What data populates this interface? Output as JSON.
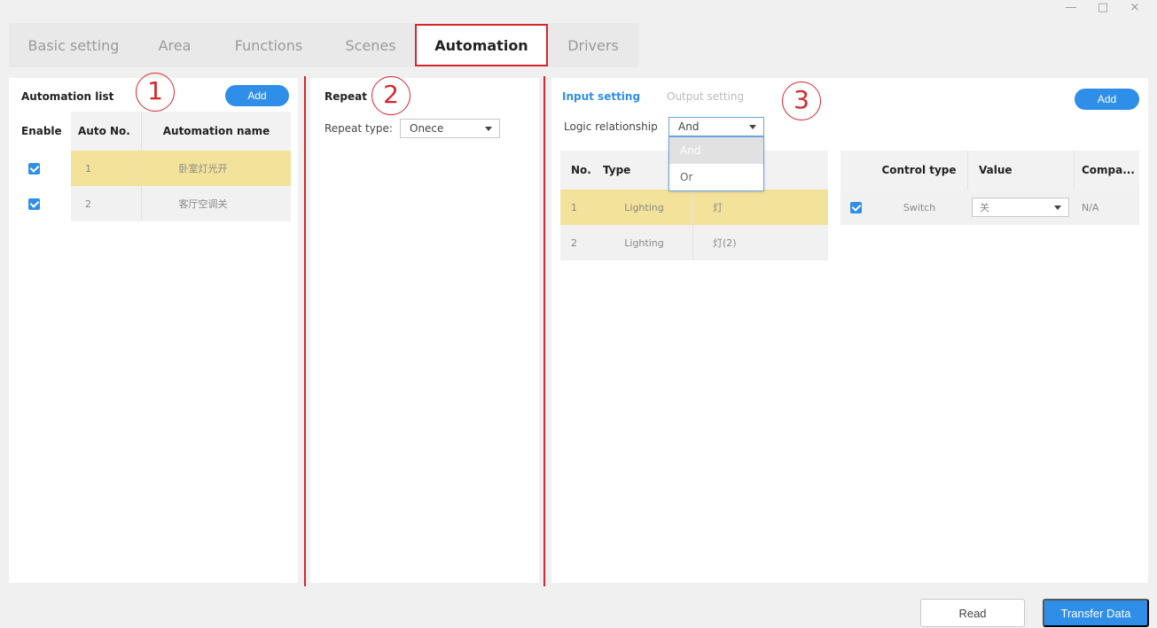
{
  "window": {
    "controls": [
      "—",
      "□",
      "×"
    ]
  },
  "tabs": [
    {
      "label": "Basic setting"
    },
    {
      "label": "Area"
    },
    {
      "label": "Functions"
    },
    {
      "label": "Scenes"
    },
    {
      "label": "Automation"
    },
    {
      "label": "Drivers"
    }
  ],
  "annotations": [
    "1",
    "2",
    "3"
  ],
  "automation_list": {
    "title": "Automation list",
    "add_label": "Add",
    "headers": {
      "enable": "Enable",
      "auto_no": "Auto No.",
      "name": "Automation name"
    },
    "rows": [
      {
        "enabled": true,
        "no": "1",
        "name": "卧室灯光开"
      },
      {
        "enabled": true,
        "no": "2",
        "name": "客厅空调关"
      }
    ]
  },
  "repeat": {
    "title": "Repeat",
    "type_label": "Repeat type:",
    "type_value": "Onece"
  },
  "io": {
    "tabs": {
      "input": "Input setting",
      "output": "Output setting"
    },
    "add_label": "Add",
    "logic_label": "Logic relationship",
    "logic_value": "And",
    "logic_options": [
      "And",
      "Or"
    ],
    "input_table": {
      "headers": {
        "no": "No.",
        "type": "Type"
      },
      "rows": [
        {
          "no": "1",
          "type": "Lighting",
          "device": "灯"
        },
        {
          "no": "2",
          "type": "Lighting",
          "device": "灯(2)"
        }
      ]
    },
    "control_table": {
      "headers": {
        "control_type": "Control type",
        "value": "Value",
        "compare": "Compa..."
      },
      "rows": [
        {
          "enabled": true,
          "control_type": "Switch",
          "value": "关",
          "compare": "N/A"
        }
      ]
    }
  },
  "footer": {
    "read_label": "Read",
    "transfer_label": "Transfer Data"
  },
  "colors": {
    "accent": "#2f8fe8",
    "highlight": "#f3e29a",
    "annotation_red": "#d8262e"
  }
}
